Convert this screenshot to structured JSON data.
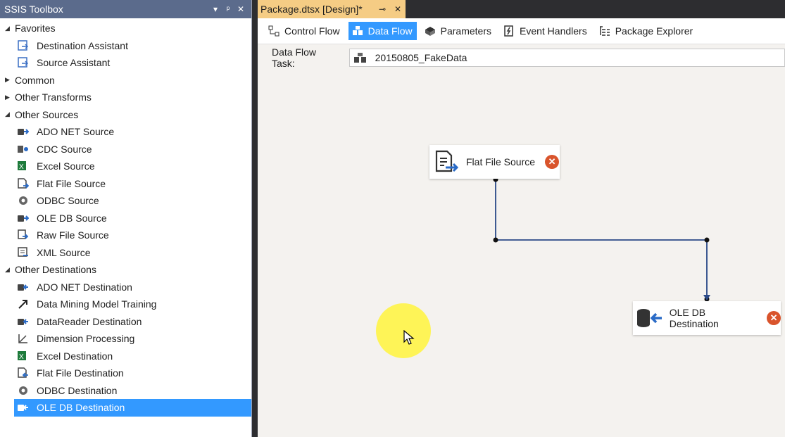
{
  "toolbox": {
    "title": "SSIS Toolbox",
    "categories": [
      {
        "name": "Favorites",
        "expanded": true,
        "items": [
          {
            "label": "Destination Assistant",
            "icon": "destination-assistant-icon"
          },
          {
            "label": "Source Assistant",
            "icon": "source-assistant-icon"
          }
        ]
      },
      {
        "name": "Common",
        "expanded": false,
        "items": []
      },
      {
        "name": "Other Transforms",
        "expanded": false,
        "items": []
      },
      {
        "name": "Other Sources",
        "expanded": true,
        "items": [
          {
            "label": "ADO NET Source",
            "icon": "ado-net-source-icon"
          },
          {
            "label": "CDC Source",
            "icon": "cdc-source-icon"
          },
          {
            "label": "Excel Source",
            "icon": "excel-source-icon"
          },
          {
            "label": "Flat File Source",
            "icon": "flat-file-source-icon"
          },
          {
            "label": "ODBC Source",
            "icon": "odbc-source-icon"
          },
          {
            "label": "OLE DB Source",
            "icon": "ole-db-source-icon"
          },
          {
            "label": "Raw File Source",
            "icon": "raw-file-source-icon"
          },
          {
            "label": "XML Source",
            "icon": "xml-source-icon"
          }
        ]
      },
      {
        "name": "Other Destinations",
        "expanded": true,
        "items": [
          {
            "label": "ADO NET Destination",
            "icon": "ado-net-destination-icon"
          },
          {
            "label": "Data Mining Model Training",
            "icon": "data-mining-icon"
          },
          {
            "label": "DataReader Destination",
            "icon": "datareader-destination-icon"
          },
          {
            "label": "Dimension Processing",
            "icon": "dimension-processing-icon"
          },
          {
            "label": "Excel Destination",
            "icon": "excel-destination-icon"
          },
          {
            "label": "Flat File Destination",
            "icon": "flat-file-destination-icon"
          },
          {
            "label": "ODBC Destination",
            "icon": "odbc-destination-icon"
          },
          {
            "label": "OLE DB Destination",
            "icon": "ole-db-destination-icon",
            "selected": true
          }
        ]
      }
    ]
  },
  "document_tab": {
    "title": "Package.dtsx [Design]*"
  },
  "design_tabs": [
    {
      "label": "Control Flow",
      "icon": "control-flow-icon",
      "active": false
    },
    {
      "label": "Data Flow",
      "icon": "data-flow-icon",
      "active": true
    },
    {
      "label": "Parameters",
      "icon": "parameters-icon",
      "active": false
    },
    {
      "label": "Event Handlers",
      "icon": "event-handlers-icon",
      "active": false
    },
    {
      "label": "Package Explorer",
      "icon": "package-explorer-icon",
      "active": false
    }
  ],
  "task": {
    "label": "Data Flow Task:",
    "value": "20150805_FakeData"
  },
  "components": {
    "source": {
      "label": "Flat File Source",
      "icon": "flat-file-source-icon",
      "status": "error"
    },
    "destination": {
      "label": "OLE DB Destination",
      "icon": "ole-db-destination-icon",
      "status": "error"
    }
  },
  "colors": {
    "accent": "#3399ff",
    "title_bar": "#5b6b8c",
    "doc_tab": "#f5cc84",
    "error": "#d9542c"
  }
}
